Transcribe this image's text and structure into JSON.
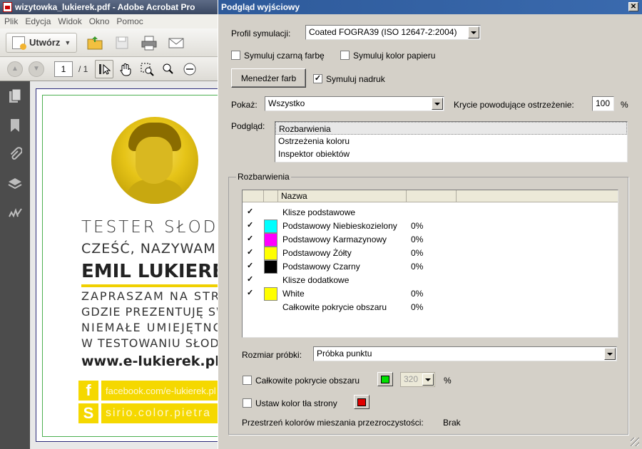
{
  "acrobat": {
    "window_title": "wizytowka_lukierek.pdf - Adobe Acrobat Pro",
    "menu": [
      "Plik",
      "Edycja",
      "Widok",
      "Okno",
      "Pomoc"
    ],
    "create_label": "Utwórz",
    "page_current": "1",
    "page_total": "/ 1"
  },
  "card": {
    "line1": "TESTER SŁODYCZY",
    "line2": "CZEŚĆ, NAZYWAM SIĘ",
    "name": "EMIL LUKIEREK",
    "line4": "ZAPRASZAM NA STRONĘ",
    "line5": "GDZIE PREZENTUJĘ SWOJE",
    "line6": "NIEMAŁE UMIEJĘTNOŚCI",
    "line7": "W TESTOWANIU SŁODYCZY",
    "website": "www.e-lukierek.pl",
    "facebook": "facebook.com/e-lukierek.pl",
    "skype": "sirio.color.pietra",
    "accent_color": "#f5d800"
  },
  "dialog": {
    "title": "Podgląd wyjściowy",
    "profile_label": "Profil symulacji:",
    "profile_value": "Coated FOGRA39 (ISO 12647-2:2004)",
    "sim_black_label": "Symuluj czarną farbę",
    "sim_paper_label": "Symuluj kolor papieru",
    "ink_manager_label": "Menedżer farb",
    "sim_overprint_label": "Symuluj nadruk",
    "show_label": "Pokaż:",
    "show_value": "Wszystko",
    "coverage_warn_label": "Krycie powodujące ostrzeżenie:",
    "coverage_warn_value": "100",
    "percent": "%",
    "preview_label": "Podgląd:",
    "preview_items": [
      "Rozbarwienia",
      "Ostrzeżenia koloru",
      "Inspektor obiektów"
    ],
    "separations_group": "Rozbarwienia",
    "grid_header_name": "Nazwa",
    "separations": [
      {
        "checked": true,
        "color": "",
        "name": "Klisze podstawowe",
        "value": ""
      },
      {
        "checked": true,
        "color": "#00ffff",
        "name": "Podstawowy Niebieskozielony",
        "value": "0%"
      },
      {
        "checked": true,
        "color": "#ff00ff",
        "name": "Podstawowy Karmazynowy",
        "value": "0%"
      },
      {
        "checked": true,
        "color": "#ffff00",
        "name": "Podstawowy Żółty",
        "value": "0%"
      },
      {
        "checked": true,
        "color": "#000000",
        "name": "Podstawowy Czarny",
        "value": "0%"
      },
      {
        "checked": true,
        "color": "",
        "name": "Klisze dodatkowe",
        "value": ""
      },
      {
        "checked": true,
        "color": "#ffff00",
        "name": "White",
        "value": "0%"
      },
      {
        "checked": false,
        "color": "",
        "name": "Całkowite pokrycie obszaru",
        "value": "0%"
      }
    ],
    "sample_size_label": "Rozmiar próbki:",
    "sample_size_value": "Próbka punktu",
    "total_coverage_label": "Całkowite pokrycie obszaru",
    "total_coverage_color": "#00e000",
    "total_coverage_value": "320",
    "page_bg_label": "Ustaw kolor tła strony",
    "page_bg_color": "#e00000",
    "blend_space_label": "Przestrzeń kolorów mieszania przezroczystości:",
    "blend_space_value": "Brak"
  }
}
